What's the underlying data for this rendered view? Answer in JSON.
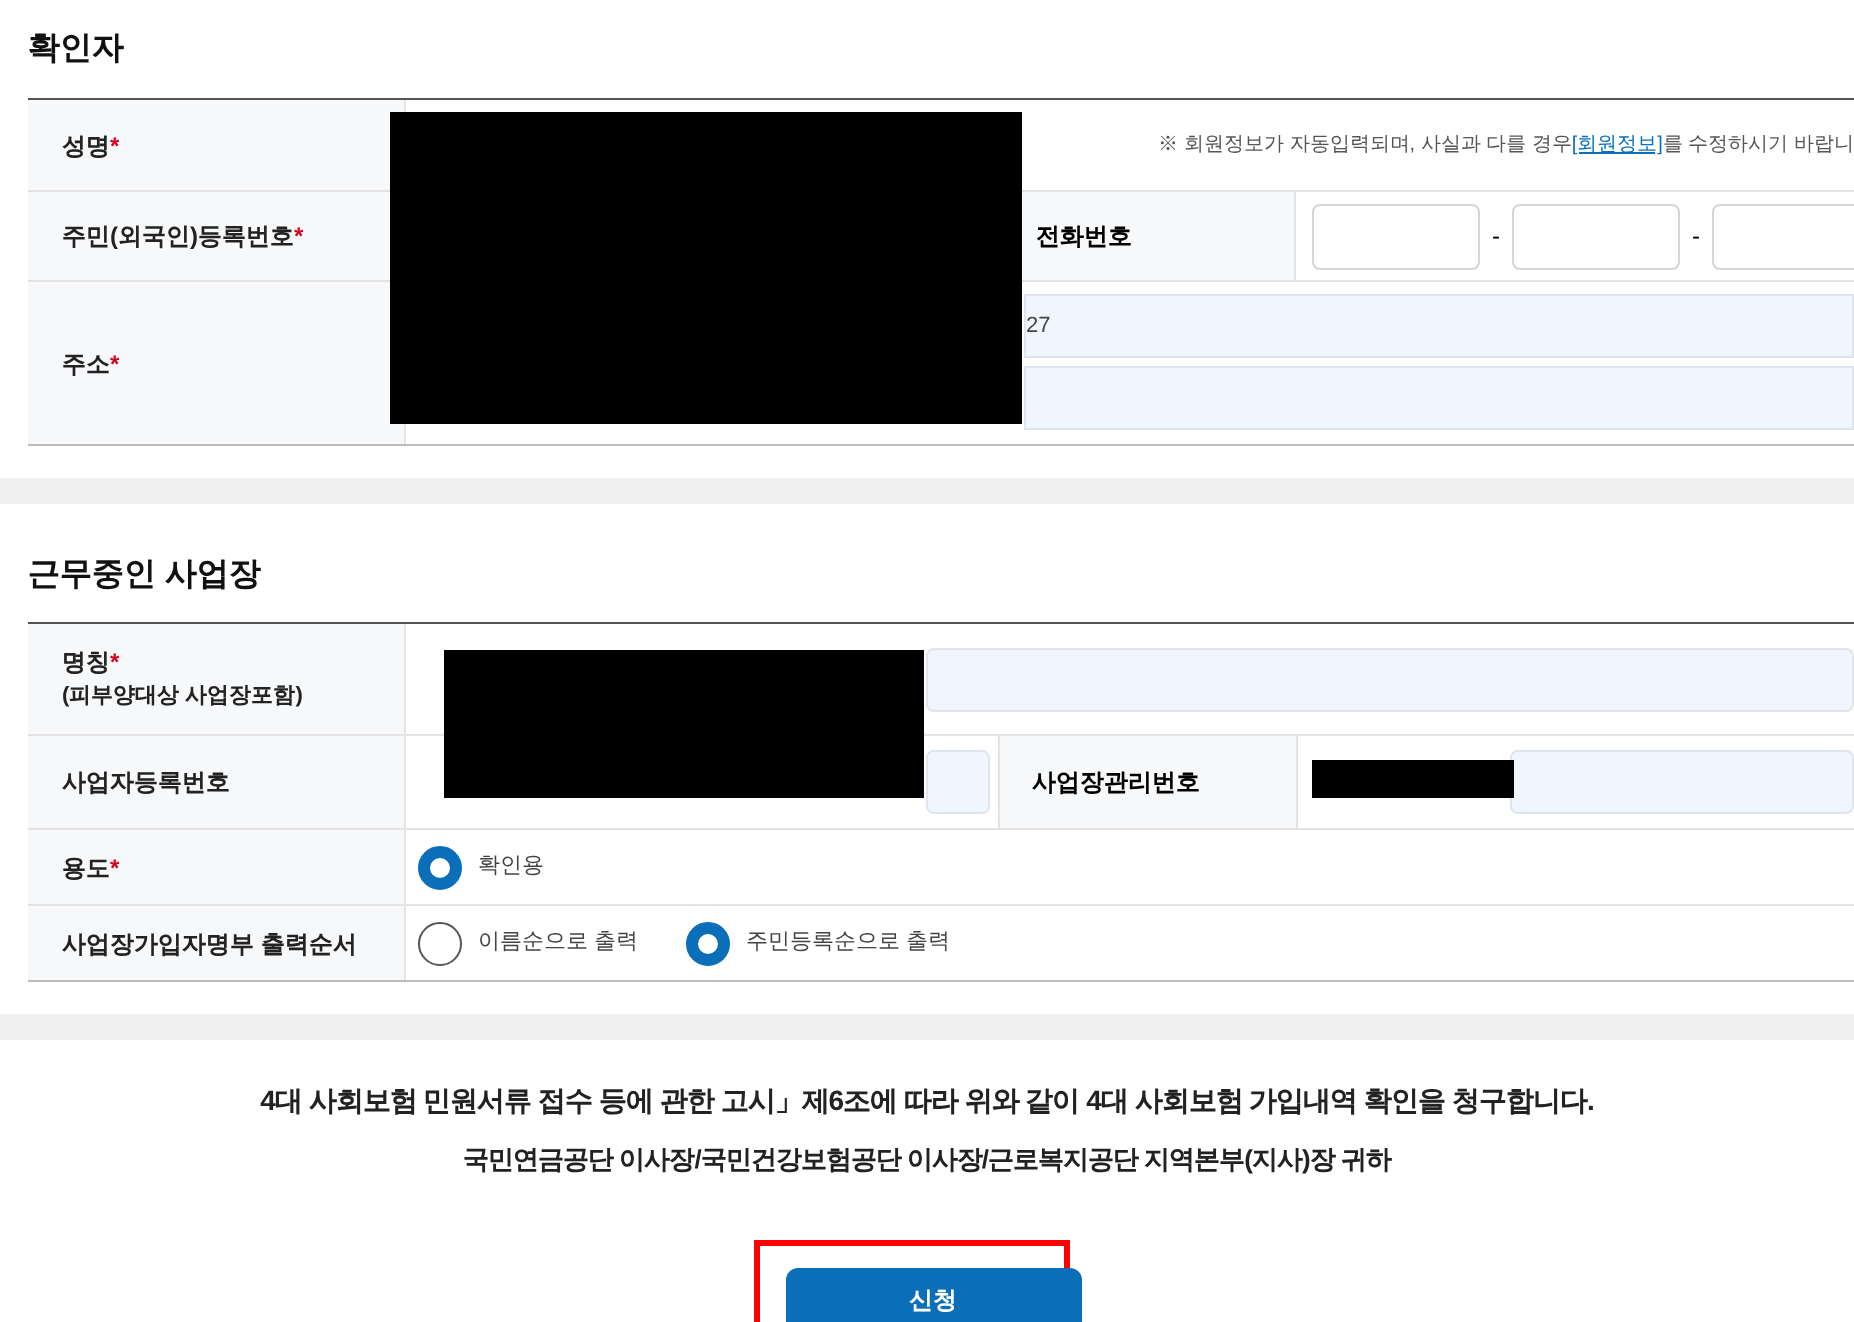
{
  "confirmer": {
    "title": "확인자",
    "name_label": "성명",
    "name_note_prefix": "※ 회원정보가 자동입력되며, 사실과 다를 경우",
    "name_note_link": "[회원정보]",
    "name_note_suffix": "를 수정하시기 바랍니",
    "id_label": "주민(외국인)등록번호",
    "phone_label": "전화번호",
    "phone_separators": [
      "-",
      "-"
    ],
    "address_label": "주소",
    "address_value": "27",
    "required_mark": "*"
  },
  "workplace": {
    "title": "근무중인 사업장",
    "name_label": "명칭",
    "name_sub": "(피부양대상 사업장포함)",
    "biz_no_label": "사업자등록번호",
    "mgmt_no_label": "사업장관리번호",
    "purpose_label": "용도",
    "purpose_options": [
      {
        "label": "확인용",
        "selected": true
      }
    ],
    "order_label": "사업장가입자명부 출력순서",
    "order_options": [
      {
        "label": "이름순으로 출력",
        "selected": false
      },
      {
        "label": "주민등록순으로 출력",
        "selected": true
      }
    ]
  },
  "notice": "4대 사회보험 민원서류 접수 등에 관한 고시」제6조에 따라 위와 같이 4대 사회보험 가입내역 확인을 청구합니다.",
  "addressee": "국민연금공단 이사장/국민건강보험공단 이사장/근로복지공단 지역본부(지사)장 귀하",
  "submit": "신청"
}
